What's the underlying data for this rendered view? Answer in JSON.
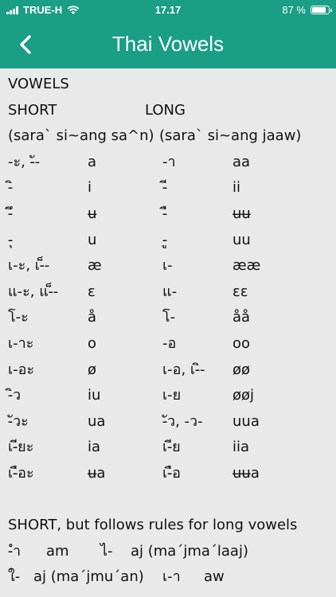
{
  "status": {
    "carrier": "TRUE-H",
    "time": "17.17",
    "battery_text": "87 %",
    "battery_level": 0.87,
    "signal_icon": "signal-icon",
    "wifi_icon": "wifi-icon"
  },
  "nav": {
    "back_icon": "chevron-left-icon",
    "title": "Thai Vowels"
  },
  "content": {
    "heading": "VOWELS",
    "short_label": "SHORT",
    "long_label": "LONG",
    "short_name": "(sara` si~ang sa^n)",
    "long_name": "(sara` si~ang jaaw)",
    "rows": [
      {
        "short_thai": "-ะ,  -ั-",
        "short_rom": "a",
        "long_thai": "-า",
        "long_rom": "aa"
      },
      {
        "short_thai": "-ิ",
        "short_rom": "i",
        "long_thai": "-ี",
        "long_rom": "ii"
      },
      {
        "short_thai": "-ึ",
        "short_rom": "ʉ",
        "long_thai": "-ื",
        "long_rom": "ʉʉ"
      },
      {
        "short_thai": "-ุ",
        "short_rom": "u",
        "long_thai": "-ู",
        "long_rom": "uu"
      },
      {
        "short_thai": "เ-ะ, เ-็-",
        "short_rom": "æ",
        "long_thai": "เ-",
        "long_rom": "ææ"
      },
      {
        "short_thai": "แ-ะ, แ-็-",
        "short_rom": "ɛ",
        "long_thai": "แ-",
        "long_rom": "ɛɛ"
      },
      {
        "short_thai": "โ-ะ",
        "short_rom": "å",
        "long_thai": "โ-",
        "long_rom": "åå"
      },
      {
        "short_thai": "เ-าะ",
        "short_rom": "o",
        "long_thai": "-อ",
        "long_rom": "oo"
      },
      {
        "short_thai": "เ-อะ",
        "short_rom": "ø",
        "long_thai": "เ-อ, เ-ิ-",
        "long_rom": "øø"
      },
      {
        "short_thai": "-ิว",
        "short_rom": "iu",
        "long_thai": "เ-ย",
        "long_rom": "øøj"
      },
      {
        "short_thai": "-ัวะ",
        "short_rom": "ua",
        "long_thai": "-ัว, -ว-",
        "long_rom": "uua"
      },
      {
        "short_thai": "เ-ียะ",
        "short_rom": "ia",
        "long_thai": "เ-ีย",
        "long_rom": "iia"
      },
      {
        "short_thai": "เ-ือะ",
        "short_rom": "ʉa",
        "long_thai": "เ-ือ",
        "long_rom": "ʉʉa"
      }
    ],
    "special_heading": "SHORT, but follows rules for long vowels",
    "special_line1": {
      "thai1": "-ำ",
      "rom1": "am",
      "thai2": "ไ-",
      "rom2": "aj  (ma´jma´laaj)"
    },
    "special_line2": {
      "thai1": "ใ-",
      "rom1": "aj  (ma´jmu´an)",
      "thai2": "เ-า",
      "rom2": "aw"
    }
  }
}
